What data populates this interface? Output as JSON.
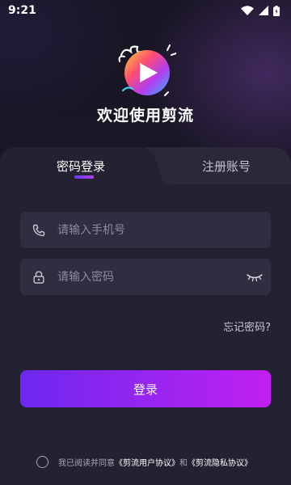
{
  "status_bar": {
    "time": "9:21"
  },
  "app": {
    "title": "欢迎使用剪流"
  },
  "tabs": {
    "login": "密码登录",
    "register": "注册账号"
  },
  "form": {
    "phone_placeholder": "请输入手机号",
    "password_placeholder": "请输入密码",
    "forgot_password": "忘记密码?",
    "login_button": "登录"
  },
  "agreement": {
    "prefix": "我已阅读并同意",
    "user_agreement": "《剪流用户协议》",
    "conjunction": "和",
    "privacy_agreement": "《剪流隐私协议》",
    "accepted": false
  },
  "colors": {
    "accent_start": "#6d28f0",
    "accent_end": "#c21ff0",
    "background": "#1a1727",
    "card": "#232132",
    "field": "#2f2d3f"
  },
  "icons": {
    "logo": "play-logo-icon",
    "phone": "phone-icon",
    "password": "lock-icon",
    "eye": "eye-closed-icon",
    "wifi": "wifi-icon",
    "signal": "signal-icon",
    "battery": "battery-icon"
  }
}
